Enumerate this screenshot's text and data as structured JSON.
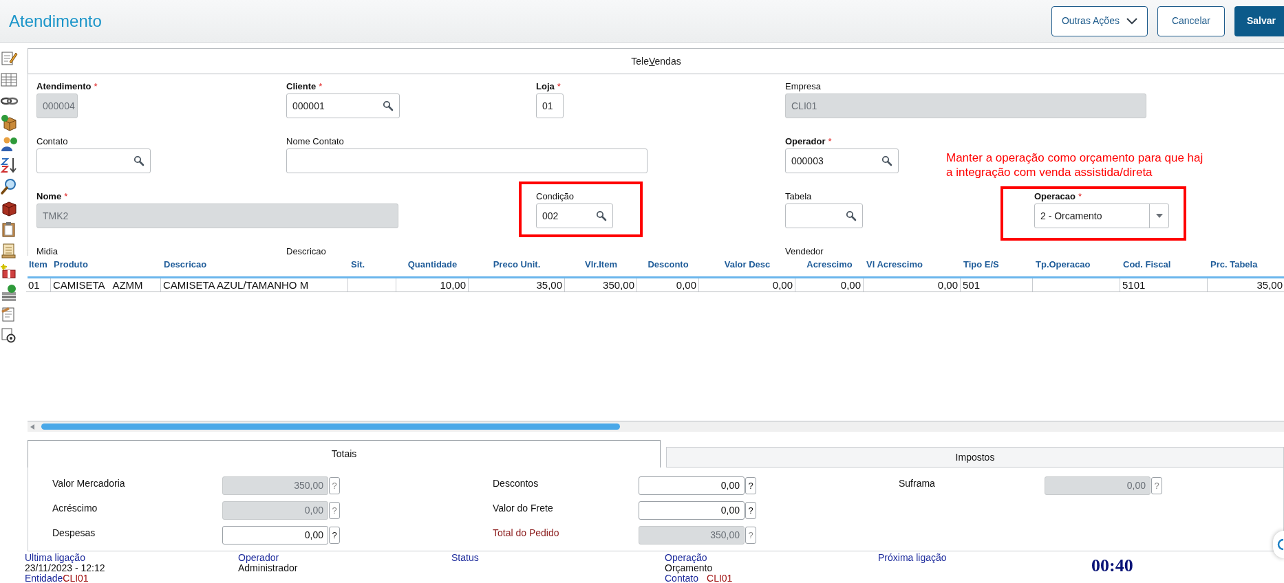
{
  "header": {
    "title": "Atendimento",
    "buttons": [
      {
        "label": "Outras Ações",
        "kind": "dropdown"
      },
      {
        "label": "Cancelar",
        "kind": "secondary"
      },
      {
        "label": "Salvar",
        "kind": "primary"
      }
    ]
  },
  "folder_tab": {
    "before": "Tele",
    "key": "V",
    "after": "endas"
  },
  "form": {
    "rows": [
      [
        {
          "label": "Atendimento",
          "required_mark": "*",
          "value": "000004",
          "readonly": true,
          "kind": "text"
        },
        {
          "label": "Cliente",
          "required_mark": "*",
          "value": "000001",
          "readonly": false,
          "kind": "lookup"
        },
        {
          "label": "Loja",
          "required_mark": "*",
          "value": "01",
          "readonly": false,
          "kind": "text"
        },
        {
          "label": "Empresa",
          "value": "CLI01",
          "readonly": true,
          "kind": "text"
        }
      ],
      [
        {
          "label": "Contato",
          "readonly": false,
          "kind": "lookup"
        },
        {
          "label": "Nome Contato",
          "readonly": false,
          "kind": "text"
        },
        null,
        {
          "label": "Operador",
          "required_mark": "*",
          "value": "000003",
          "readonly": false,
          "kind": "lookup"
        }
      ],
      [
        {
          "label": "Nome",
          "required_mark": "*",
          "value": "TMK2",
          "readonly": true,
          "kind": "text"
        },
        null,
        {
          "label": "Condição",
          "value": "002",
          "readonly": false,
          "kind": "lookup"
        },
        {
          "label": "Tabela",
          "readonly": false,
          "kind": "lookup"
        },
        {
          "label": "Operacao",
          "required_mark": "*",
          "value": "2 - Orcamento",
          "readonly": false,
          "kind": "select"
        }
      ]
    ],
    "partial_labels": [
      "Midia",
      "Descricao",
      "Vendedor"
    ]
  },
  "annotation": {
    "lines": [
      "Manter a operação como orçamento para que haj",
      "a integração com venda assistida/direta"
    ]
  },
  "table": {
    "columns": [
      "Item",
      "Produto",
      "Descricao",
      "Sit.",
      "Quantidade",
      "Preco Unit.",
      "Vlr.Item",
      "Desconto",
      "Valor Desc",
      "Acrescimo",
      "Vl Acrescimo",
      "Tipo E/S",
      "Tp.Operacao",
      "Cod. Fiscal",
      "Prc. Tabela"
    ],
    "rows": [
      [
        "01",
        "CAMISETA   AZMM",
        "CAMISETA AZUL/TAMANHO M",
        "",
        "10,00",
        "35,00",
        "350,00",
        "0,00",
        "0,00",
        "0,00",
        "0,00",
        "501",
        "",
        "5101",
        "35,00"
      ]
    ]
  },
  "totals": {
    "tabs": [
      {
        "label": "Totais",
        "selected": true
      },
      {
        "label": "Impostos",
        "selected": false
      }
    ],
    "columns": [
      [
        {
          "label": "Valor Mercadoria",
          "value": "350,00",
          "readonly": true,
          "help": "?"
        },
        {
          "label": "Acréscimo",
          "value": "0,00",
          "readonly": true,
          "help": "?"
        },
        {
          "label": "Despesas",
          "value": "0,00",
          "readonly": false,
          "help": "?"
        }
      ],
      [
        {
          "label": "Descontos",
          "value": "0,00",
          "readonly": false,
          "help": "?"
        },
        {
          "label": "Valor do Frete",
          "value": "0,00",
          "readonly": false,
          "help": "?"
        },
        {
          "label": "Total do Pedido",
          "value": "350,00",
          "readonly": true,
          "emphasis": true,
          "help": "?"
        }
      ],
      [
        {
          "label": "Suframa",
          "value": "0,00",
          "readonly": true,
          "help": "?"
        }
      ]
    ]
  },
  "status_bar": {
    "columns": [
      {
        "label": "Ultima ligação",
        "value": "23/11/2023 - 12:12",
        "extra_label": "Entidade",
        "extra_value": "CLI01"
      },
      {
        "label": "Operador",
        "value": "Administrador"
      },
      {
        "label": "Status"
      },
      {
        "label": "Operação",
        "value": "Orçamento",
        "extra_label": "Contato",
        "extra_value": "CLI01"
      },
      {
        "label": "Próxima ligação"
      }
    ],
    "timer": "00:40"
  }
}
